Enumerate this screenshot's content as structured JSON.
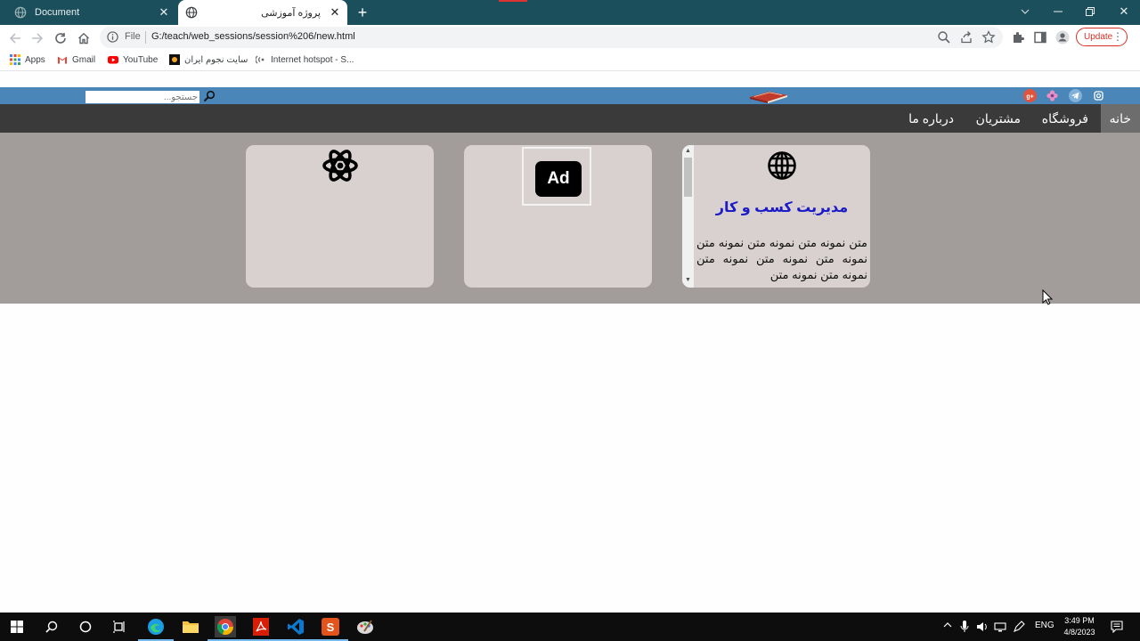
{
  "browser": {
    "tabs": [
      {
        "title": "Document",
        "active": false
      },
      {
        "title": "پروژه آموزشی",
        "active": true
      }
    ],
    "url_scheme_label": "File",
    "url": "G:/teach/web_sessions/session%206/new.html",
    "update_label": "Update",
    "bookmarks": [
      {
        "label": "Apps",
        "icon": "apps-grid-icon"
      },
      {
        "label": "Gmail",
        "icon": "gmail-icon"
      },
      {
        "label": "YouTube",
        "icon": "youtube-icon"
      },
      {
        "label": "سایت نجوم ایران",
        "icon": "site-icon"
      },
      {
        "label": "Internet hotspot - S...",
        "icon": "hotspot-icon"
      }
    ]
  },
  "page": {
    "search": {
      "placeholder": "جستجو..."
    },
    "menu": [
      {
        "label": "خانه",
        "active": true
      },
      {
        "label": "فروشگاه",
        "active": false
      },
      {
        "label": "مشتریان",
        "active": false
      },
      {
        "label": "درباره ما",
        "active": false
      }
    ],
    "cards": [
      {
        "icon": "atom-icon"
      },
      {
        "icon": "ad-icon",
        "icon_text": "Ad"
      },
      {
        "icon": "globe-icon",
        "title": "مدیریت کسب و کار",
        "text": "متن نمونه متن نمونه متن نمونه متن نمونه متن نمونه متن نمونه متن نمونه متن نمونه متن"
      }
    ],
    "colors": {
      "topbar": "#4a86b8",
      "menubar": "#3b3a3b",
      "content": "#a29c9a",
      "card": "#d8d1cf",
      "card_title": "#1b1bc7"
    }
  },
  "taskbar": {
    "language": "ENG",
    "time": "3:49 PM",
    "date": "4/8/2023"
  }
}
